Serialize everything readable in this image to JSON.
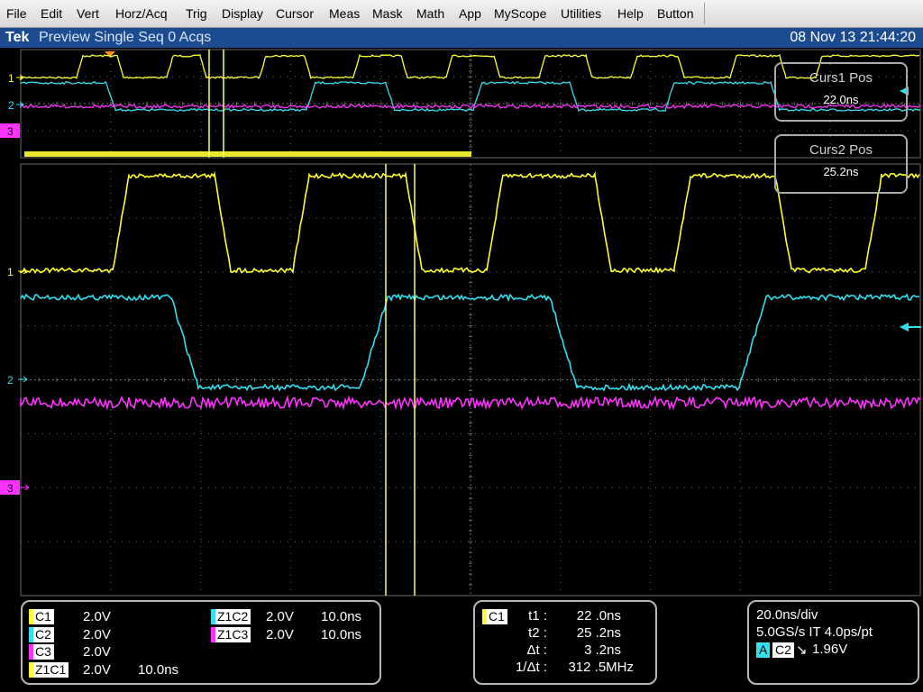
{
  "menu": [
    "File",
    "Edit",
    "Vert",
    "Horz/Acq",
    "Trig",
    "Display",
    "Cursor",
    "Meas",
    "Mask",
    "Math",
    "App",
    "MyScope",
    "Utilities",
    "Help",
    "Button"
  ],
  "status": {
    "brand": "Tek",
    "mode": "Preview  Single Seq  0 Acqs",
    "datetime": "08 Nov 13 21:44:20"
  },
  "colors": {
    "ch1": "#ffff33",
    "ch2": "#33e0f0",
    "ch3": "#ff33ff",
    "cursor": "#ffff66",
    "grid": "#6a6a6a",
    "bg": "#000000"
  },
  "overview": {
    "labels": [
      "1",
      "2",
      "3"
    ]
  },
  "main": {
    "labels": [
      "1",
      "2",
      "3"
    ]
  },
  "cursors": {
    "curs1": {
      "label": "Curs1 Pos",
      "value": "22.0ns"
    },
    "curs2": {
      "label": "Curs2 Pos",
      "value": "25.2ns"
    }
  },
  "channels": [
    {
      "name": "C1",
      "scale": "2.0V",
      "extra": ""
    },
    {
      "name": "C2",
      "scale": "2.0V",
      "extra": ""
    },
    {
      "name": "C3",
      "scale": "2.0V",
      "extra": ""
    },
    {
      "name": "Z1C1",
      "scale": "2.0V",
      "extra": "10.0ns"
    },
    {
      "name": "Z1C2",
      "scale": "2.0V",
      "extra": "10.0ns"
    },
    {
      "name": "Z1C3",
      "scale": "2.0V",
      "extra": "10.0ns"
    }
  ],
  "measure": {
    "source": "C1",
    "rows": [
      {
        "label": "t1 :",
        "value": "22 .0ns"
      },
      {
        "label": "t2 :",
        "value": "25 .2ns"
      },
      {
        "label": "Δt :",
        "value": "3 .2ns"
      },
      {
        "label": "1/Δt :",
        "value": "312 .5MHz"
      }
    ]
  },
  "timebase": {
    "div": "20.0ns/div",
    "rate": "5.0GS/s IT 4.0ps/pt",
    "trig_mode": "A",
    "trig_source": "C2",
    "trig_slope": "↘",
    "trig_level": "1.96V"
  }
}
